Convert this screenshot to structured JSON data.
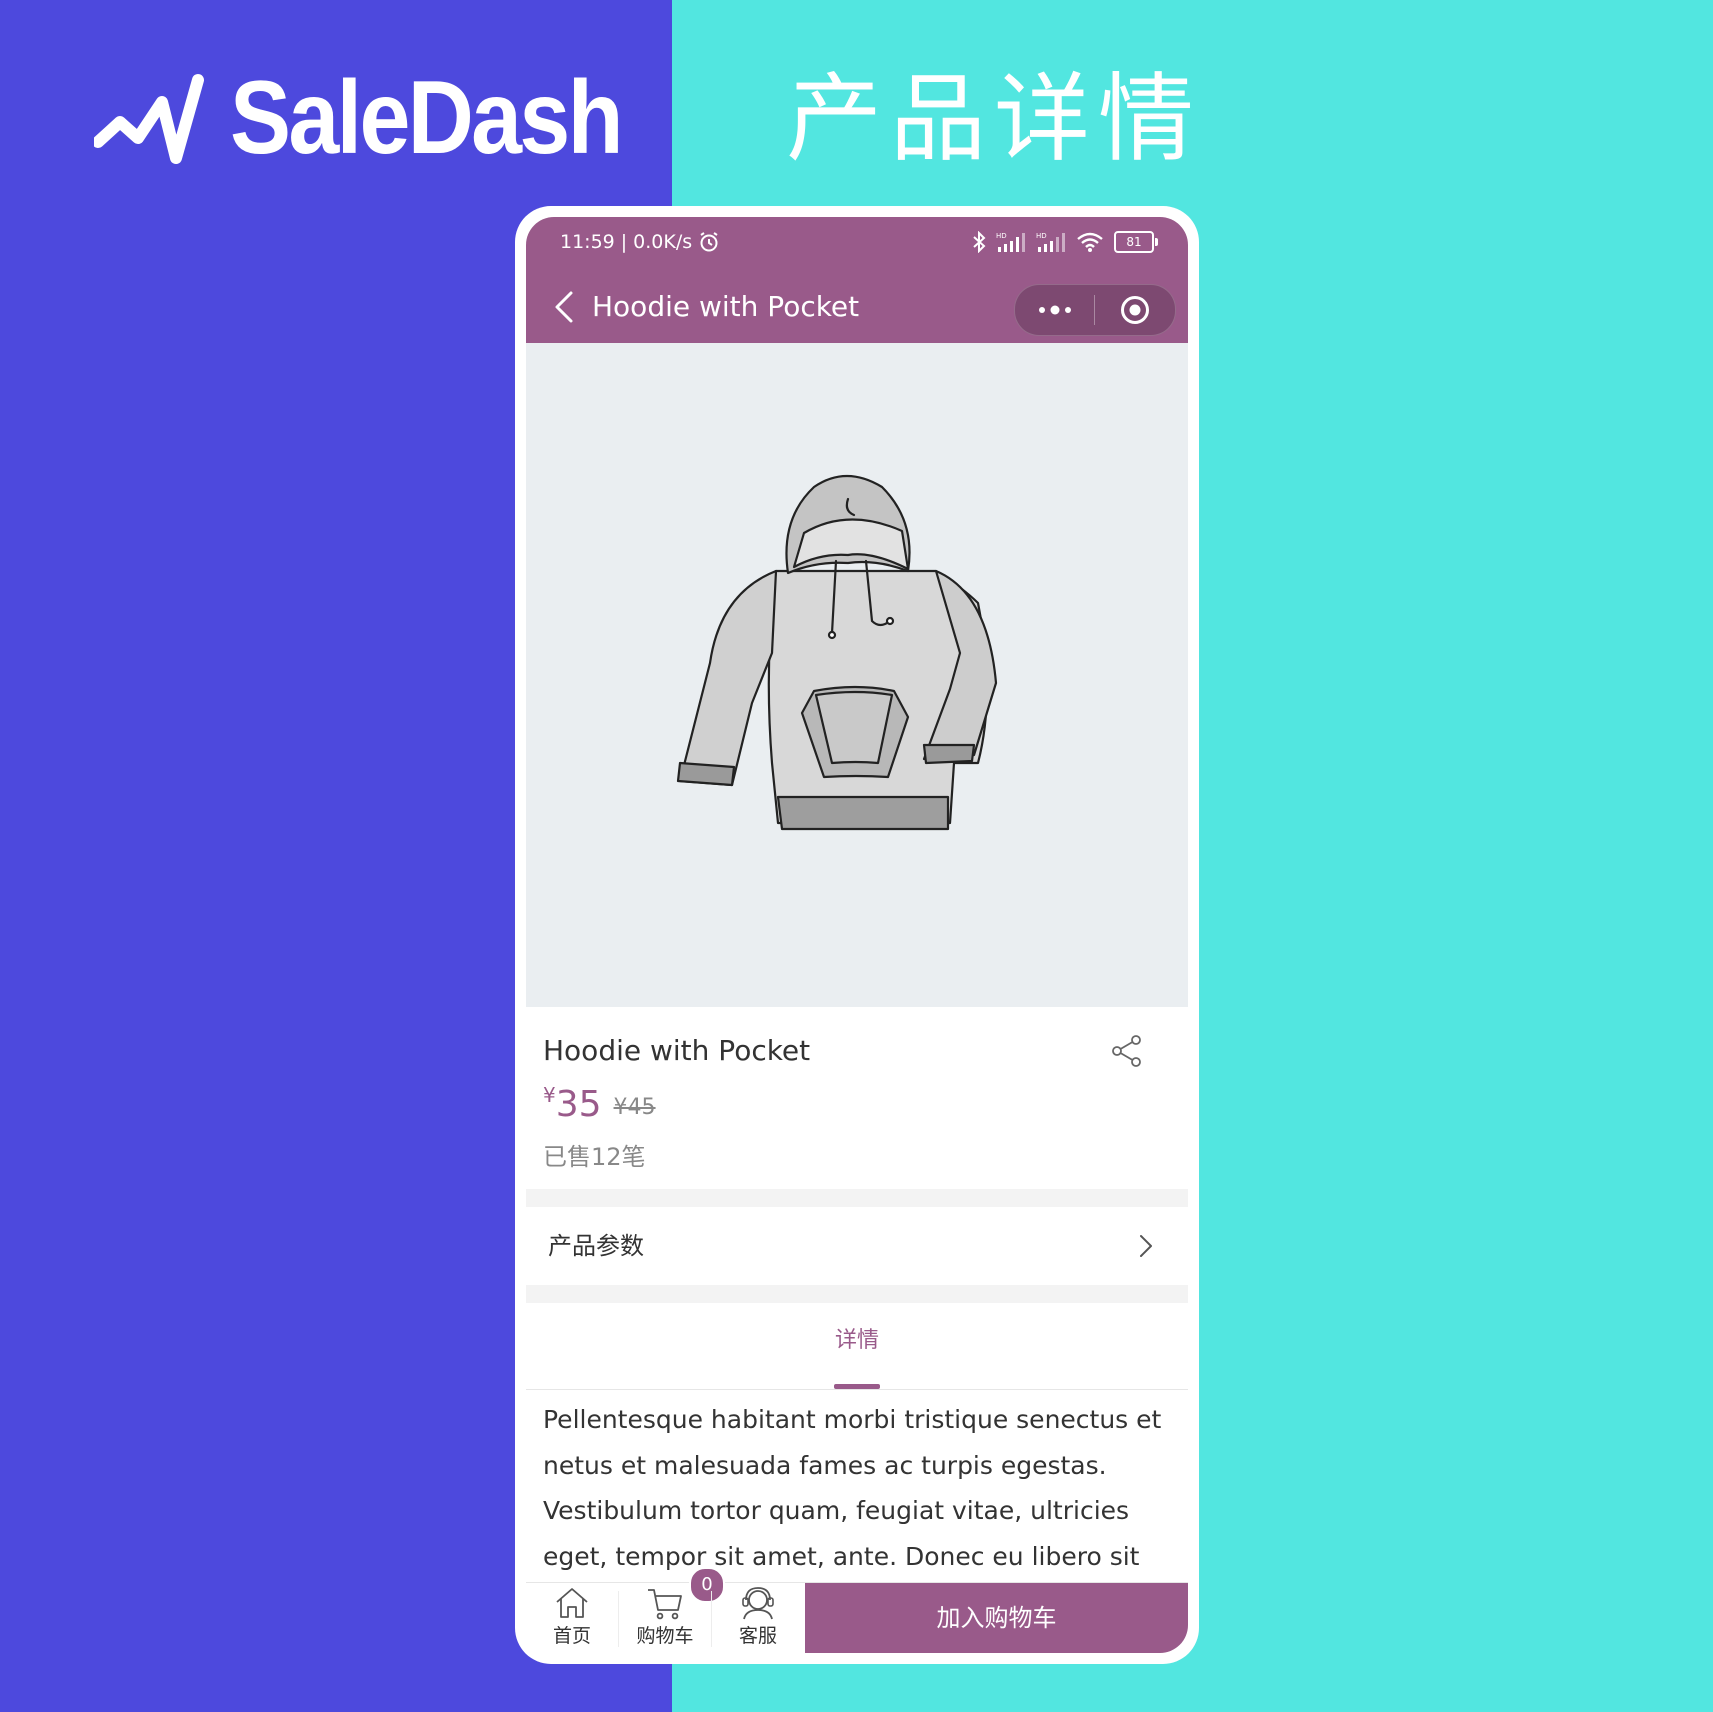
{
  "brand": {
    "name": "SaleDash",
    "logo_icon": "trend-line-icon"
  },
  "page_heading": "产品详情",
  "status_bar": {
    "time": "11:59",
    "network_speed": "0.0K/s",
    "battery": "81",
    "icons": [
      "alarm-icon",
      "bluetooth-icon",
      "signal-hd-icon",
      "signal-hd-icon",
      "wifi-icon",
      "battery-icon"
    ]
  },
  "navbar": {
    "title": "Hoodie with Pocket",
    "back_icon": "chevron-left-icon",
    "more_icon": "more-dots-icon",
    "close_icon": "target-circle-icon",
    "color": "#995a8a"
  },
  "product": {
    "image_icon": "hoodie-illustration",
    "name": "Hoodie with Pocket",
    "currency": "¥",
    "price": "35",
    "original_price": "¥45",
    "sold": "已售12笔",
    "share_icon": "share-icon"
  },
  "specs": {
    "label": "产品参数",
    "chevron_icon": "chevron-right-icon"
  },
  "tabs": [
    {
      "label": "详情",
      "active": true
    }
  ],
  "description": "Pellentesque habitant morbi tristique senectus et netus et malesuada fames ac turpis egestas. Vestibulum tortor quam, feugiat vitae, ultricies eget, tempor sit amet, ante. Donec eu libero sit amet quam egestas se",
  "tabbar": {
    "home": {
      "label": "首页",
      "icon": "home-icon"
    },
    "cart": {
      "label": "购物车",
      "icon": "cart-icon",
      "badge": "0"
    },
    "service": {
      "label": "客服",
      "icon": "headset-icon"
    },
    "add_to_cart": "加入购物车"
  },
  "colors": {
    "left_bg": "#4d49dd",
    "right_bg": "#52e6e0",
    "accent": "#995a8a"
  }
}
